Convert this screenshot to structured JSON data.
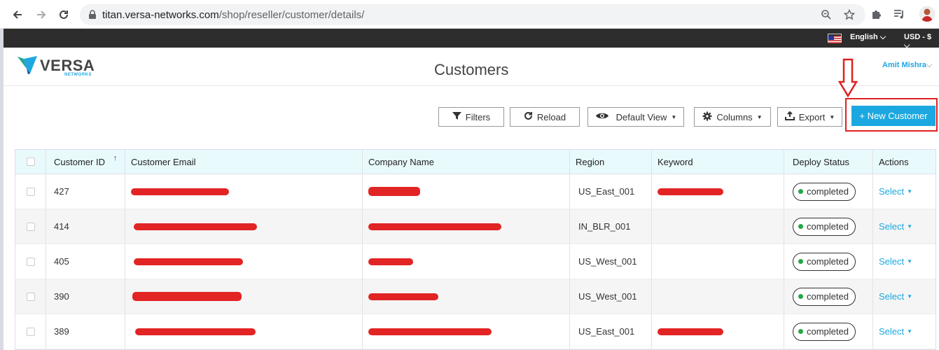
{
  "browser": {
    "url_host": "titan.versa-networks.com",
    "url_path": "/shop/reseller/customer/details/"
  },
  "topbar": {
    "language": "English",
    "currency": "USD - $"
  },
  "header": {
    "logo_text": "VERSA",
    "logo_sub": "NETWORKS",
    "title": "Customers",
    "user": "Amit Mishra"
  },
  "toolbar": {
    "filters": "Filters",
    "reload": "Reload",
    "default_view": "Default View",
    "columns": "Columns",
    "export": "Export",
    "new_customer": "+ New Customer"
  },
  "table": {
    "headers": {
      "customer_id": "Customer ID",
      "customer_email": "Customer Email",
      "company_name": "Company Name",
      "region": "Region",
      "keyword": "Keyword",
      "deploy_status": "Deploy Status",
      "actions": "Actions"
    },
    "rows": [
      {
        "id": "427",
        "region": "US_East_001",
        "status": "completed",
        "action": "Select"
      },
      {
        "id": "414",
        "region": "IN_BLR_001",
        "status": "completed",
        "action": "Select"
      },
      {
        "id": "405",
        "region": "US_West_001",
        "status": "completed",
        "action": "Select"
      },
      {
        "id": "390",
        "region": "US_West_001",
        "status": "completed",
        "action": "Select"
      },
      {
        "id": "389",
        "region": "US_East_001",
        "status": "completed",
        "action": "Select"
      }
    ]
  },
  "colors": {
    "accent": "#1ba8e0",
    "header_bg": "#e9fafd",
    "status_dot": "#22a845",
    "annotation": "#e02020"
  }
}
